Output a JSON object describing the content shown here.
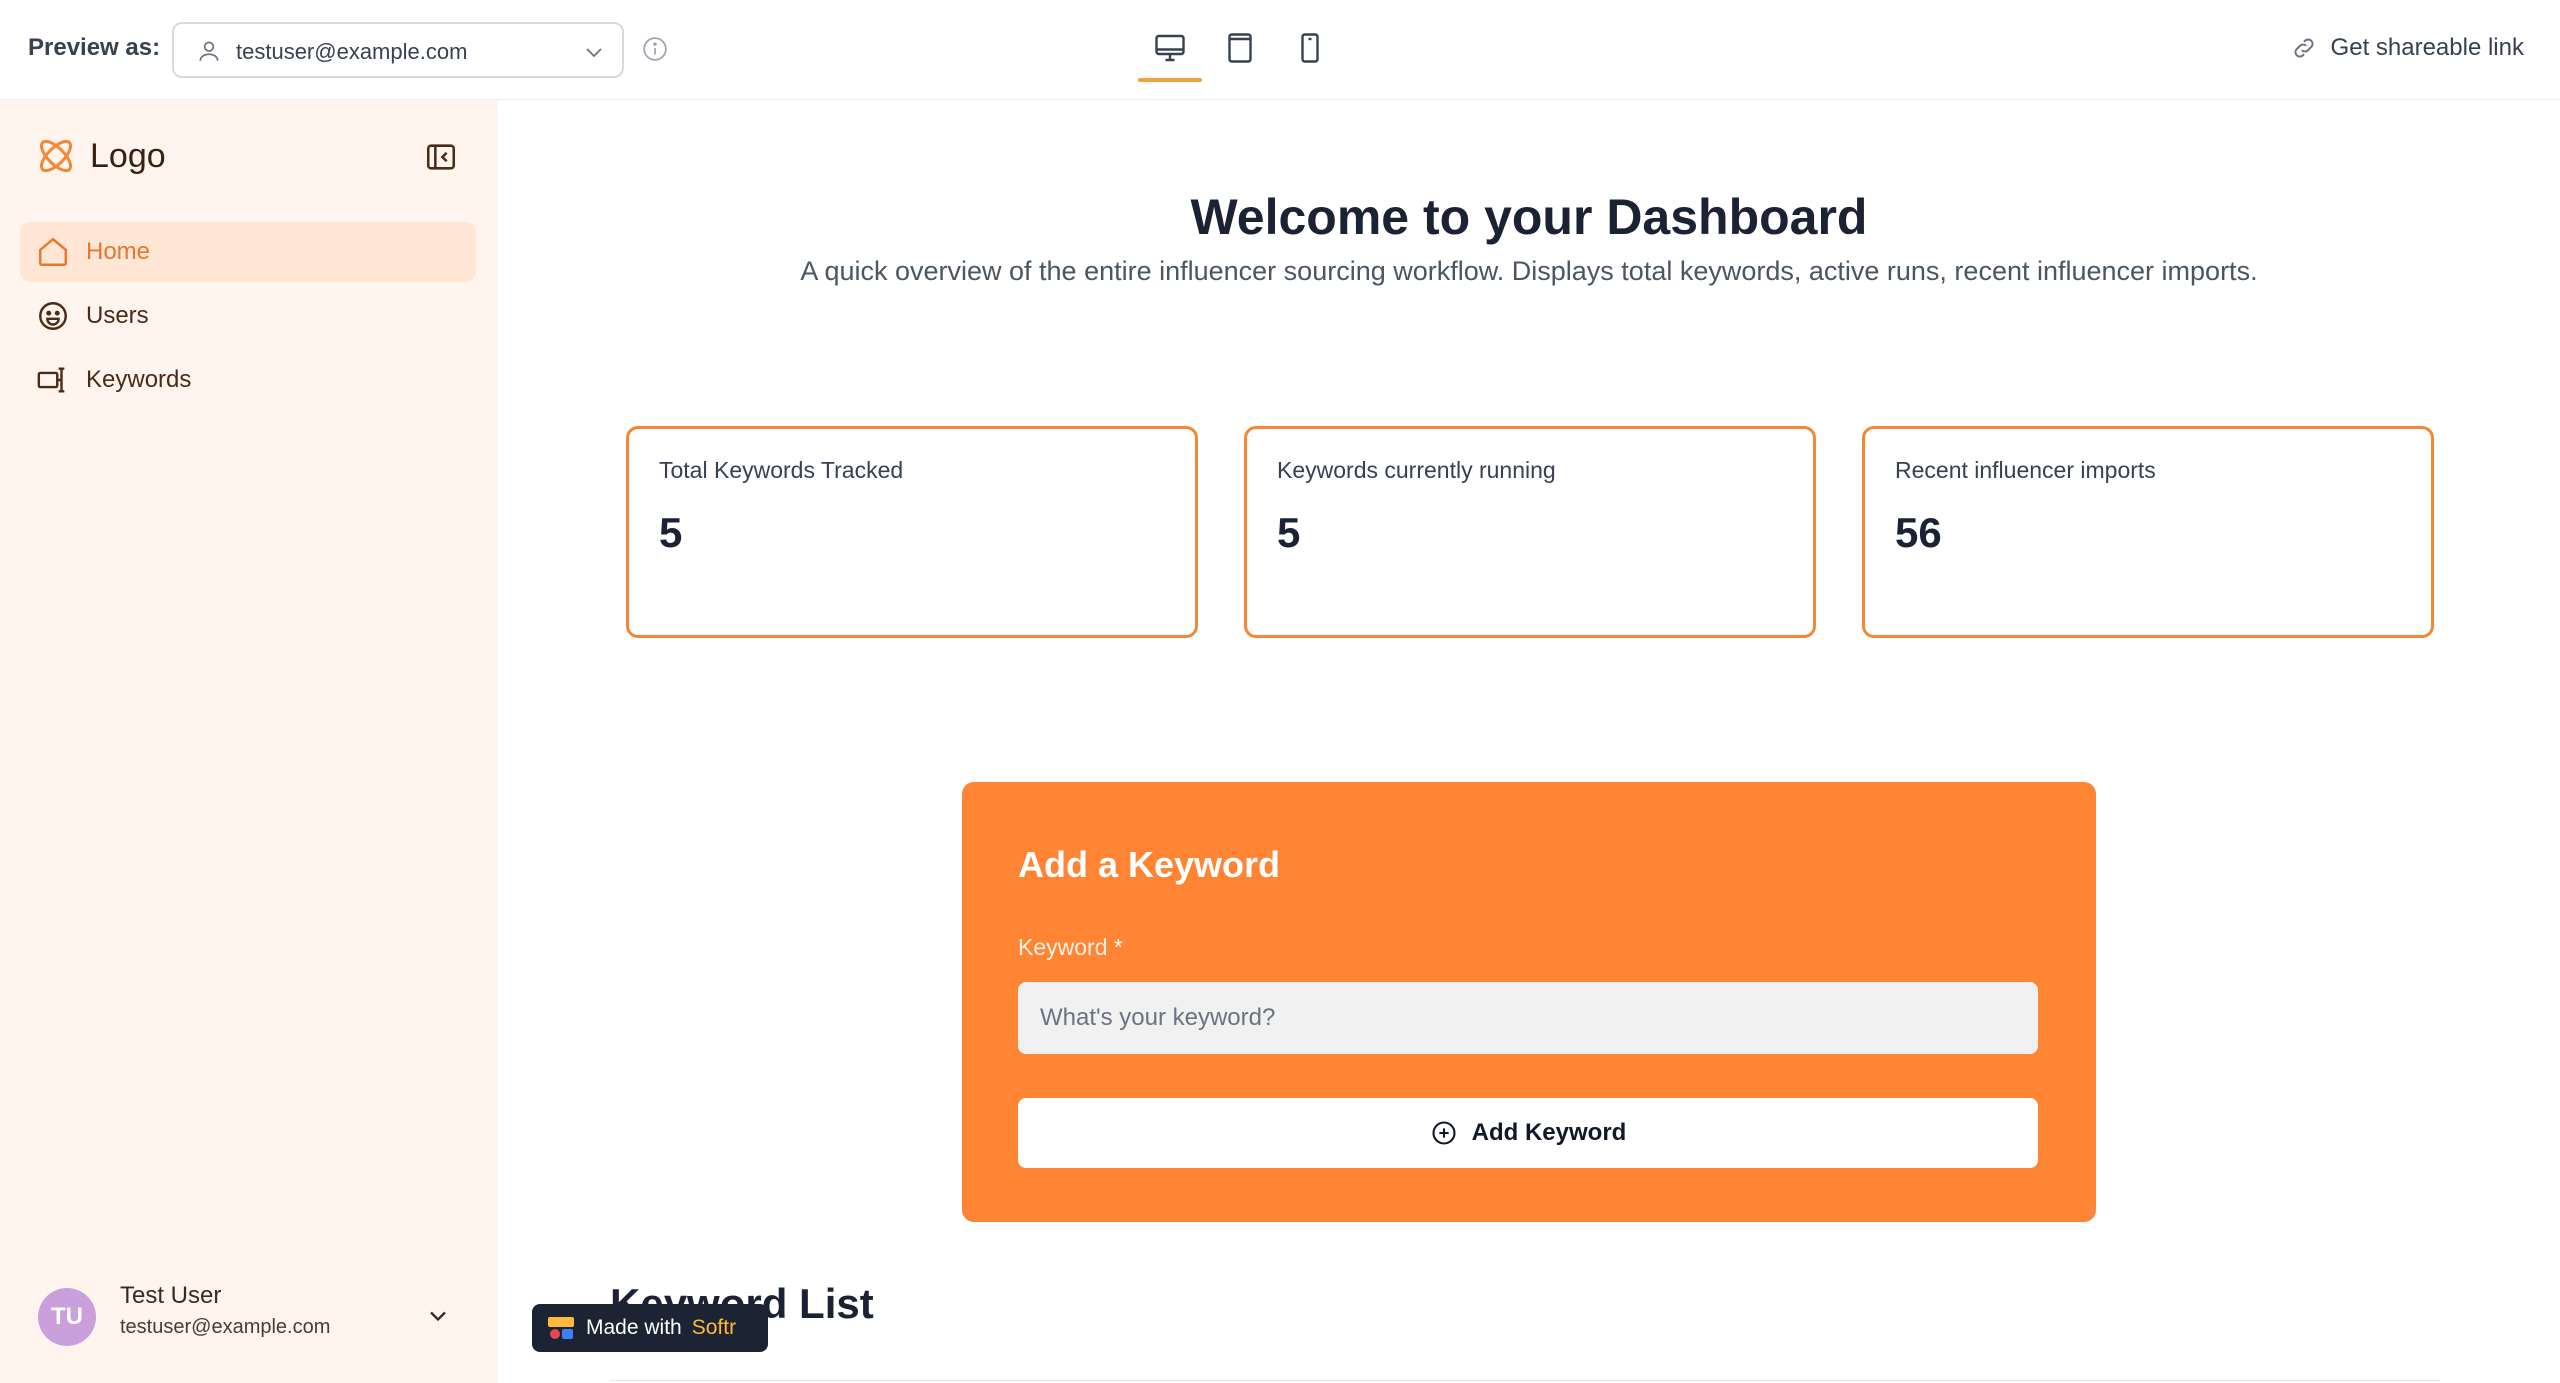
{
  "topbar": {
    "preview_label": "Preview as:",
    "selected_user": "testuser@example.com",
    "share_label": "Get shareable link",
    "devices": [
      "desktop-icon",
      "tablet-icon",
      "mobile-icon"
    ],
    "active_device": "desktop"
  },
  "sidebar": {
    "logo_text": "Logo",
    "items": [
      {
        "label": "Home",
        "icon": "home-icon",
        "active": true
      },
      {
        "label": "Users",
        "icon": "smiley-icon",
        "active": false
      },
      {
        "label": "Keywords",
        "icon": "keyword-icon",
        "active": false
      }
    ],
    "profile": {
      "initials": "TU",
      "name": "Test User",
      "email": "testuser@example.com"
    }
  },
  "hero": {
    "title": "Welcome to your Dashboard",
    "subtitle": "A quick overview of the entire influencer sourcing workflow. Displays total keywords, active runs, recent influencer imports."
  },
  "stats": [
    {
      "label": "Total Keywords Tracked",
      "value": "5"
    },
    {
      "label": "Keywords currently running",
      "value": "5"
    },
    {
      "label": "Recent influencer imports",
      "value": "56"
    }
  ],
  "keyword_form": {
    "title": "Add a Keyword",
    "field_label": "Keyword *",
    "placeholder": "What's your keyword?",
    "button_label": "Add Keyword"
  },
  "keyword_list": {
    "title": "Keyword List"
  },
  "badge": {
    "prefix": "Made with",
    "brand": "Softr"
  },
  "colors": {
    "accent": "#ff8534",
    "card_border": "#f58734",
    "sidebar_bg": "#fff5ee",
    "nav_active_bg": "#ffe6d5"
  }
}
